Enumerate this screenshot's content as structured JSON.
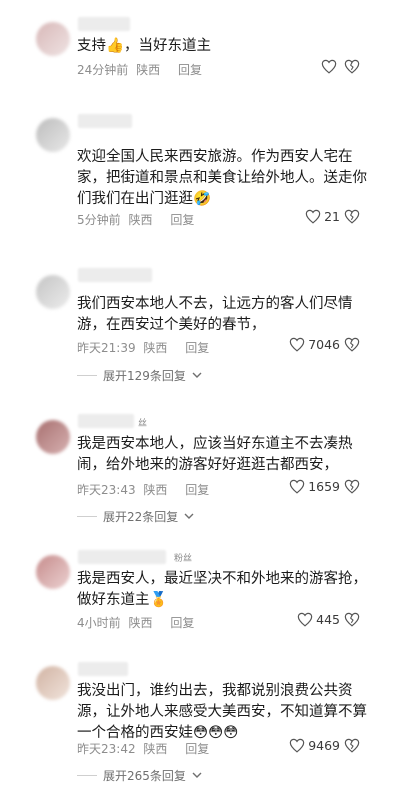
{
  "comments": [
    {
      "text": "支持👍，当好东道主",
      "time": "24分钟前",
      "location": "陕西",
      "reply": "回复",
      "likes": "",
      "fan_tag": "",
      "expand": ""
    },
    {
      "text": "欢迎全国人民来西安旅游。作为西安人宅在家，把街道和景点和美食让给外地人。送走你们我们在出门逛逛🤣",
      "time": "5分钟前",
      "location": "陕西",
      "reply": "回复",
      "likes": "21",
      "fan_tag": "",
      "expand": ""
    },
    {
      "text": "我们西安本地人不去，让远方的客人们尽情游，在西安过个美好的春节，",
      "time": "昨天21:39",
      "location": "陕西",
      "reply": "回复",
      "likes": "7046",
      "fan_tag": "",
      "expand": "展开129条回复"
    },
    {
      "text": "我是西安本地人，应该当好东道主不去凑热闹，给外地来的游客好好逛逛古都西安，",
      "time": "昨天23:43",
      "location": "陕西",
      "reply": "回复",
      "likes": "1659",
      "fan_tag": "丝",
      "expand": "展开22条回复"
    },
    {
      "text": "我是西安人，最近坚决不和外地来的游客抢，做好东道主🏅",
      "time": "4小时前",
      "location": "陕西",
      "reply": "回复",
      "likes": "445",
      "fan_tag": "粉丝",
      "expand": ""
    },
    {
      "text": "我没出门，谁约出去，我都说别浪费公共资源，让外地人来感受大美西安，不知道算不算一个合格的西安娃😳😳😳",
      "time": "昨天23:42",
      "location": "陕西",
      "reply": "回复",
      "likes": "9469",
      "fan_tag": "",
      "expand": "展开265条回复"
    }
  ],
  "icons": {
    "like": "heart-outline-icon",
    "dislike": "broken-heart-outline-icon",
    "expand": "chevron-down-icon"
  },
  "colors": {
    "text": "#1b1b1b",
    "meta": "#8d8d8d",
    "background": "#ffffff"
  }
}
